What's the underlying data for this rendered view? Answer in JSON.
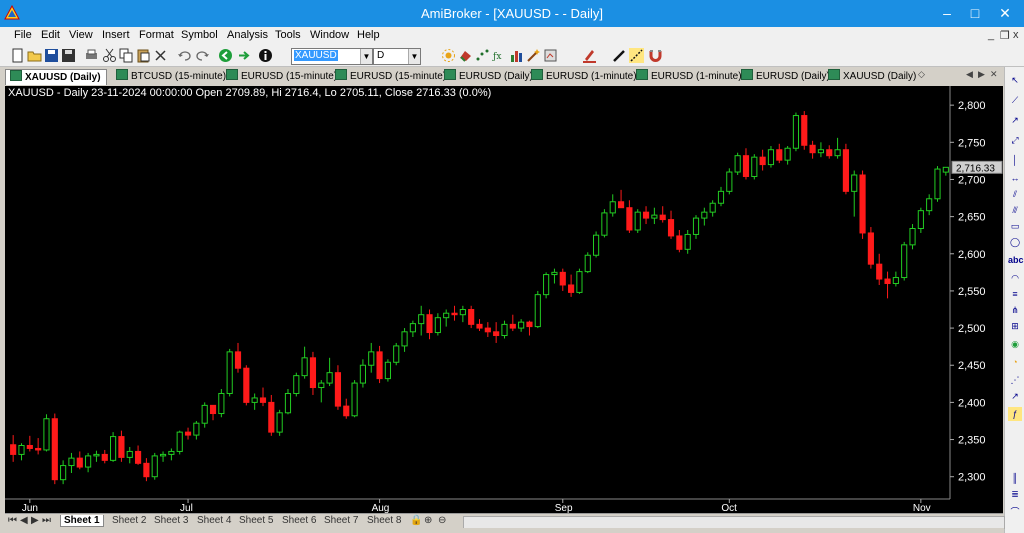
{
  "window": {
    "title": "AmiBroker - [XAUUSD -  - Daily]",
    "minimize": "–",
    "maximize": "□",
    "close": "✕",
    "mdi_min": "_",
    "mdi_restore": "❐",
    "mdi_close": "x"
  },
  "menu": [
    "File",
    "Edit",
    "View",
    "Insert",
    "Format",
    "Symbol",
    "Analysis",
    "Tools",
    "Window",
    "Help"
  ],
  "toolbar": {
    "symbol": "XAUUSD",
    "interval": "D"
  },
  "tabs": [
    "XAUUSD (Daily)",
    "BTCUSD (15-minute)",
    "EURUSD (15-minute)",
    "EURUSD (15-minute)",
    "EURUSD (Daily)",
    "EURUSD (1-minute)",
    "EURUSD (1-minute)",
    "EURUSD (Daily)",
    "XAUUSD (Daily)"
  ],
  "chart_info": "XAUUSD - Daily 23-11-2024 00:00:00 Open 2709.89, Hi 2716.4, Lo 2705.11, Close 2716.33 (0.0%)",
  "sheets": [
    "Sheet 1",
    "Sheet 2",
    "Sheet 3",
    "Sheet 4",
    "Sheet 5",
    "Sheet 6",
    "Sheet 7",
    "Sheet 8"
  ],
  "colors": {
    "up": "#22cc22",
    "down": "#ff1a1a",
    "background": "#000000",
    "axis_text": "#ffffff",
    "price_tag": "#cfcfcf"
  },
  "chart_data": {
    "type": "candlestick",
    "title": "XAUUSD - Daily 23-11-2024 00:00:00 Open 2709.89, Hi 2716.4, Lo 2705.11, Close 2716.33 (0.0%)",
    "ylim": [
      2270,
      2815
    ],
    "yticks": [
      2300,
      2350,
      2400,
      2450,
      2500,
      2550,
      2600,
      2650,
      2700,
      2750,
      2800
    ],
    "ytick_labels": [
      "2,300",
      "2,350",
      "2,400",
      "2,450",
      "2,500",
      "2,550",
      "2,600",
      "2,650",
      "2,700",
      "2,750",
      "2,800"
    ],
    "x_month_labels": [
      {
        "label": "Jun",
        "index": 2
      },
      {
        "label": "Jul",
        "index": 21
      },
      {
        "label": "Aug",
        "index": 44
      },
      {
        "label": "Sep",
        "index": 66
      },
      {
        "label": "Oct",
        "index": 86
      },
      {
        "label": "Nov",
        "index": 109
      }
    ],
    "last_price_label": "2,716.33",
    "last_price": 2716.33,
    "candles": [
      [
        2343,
        2356,
        2320,
        2330
      ],
      [
        2330,
        2345,
        2322,
        2342
      ],
      [
        2342,
        2355,
        2334,
        2338
      ],
      [
        2338,
        2352,
        2330,
        2336
      ],
      [
        2336,
        2384,
        2334,
        2378
      ],
      [
        2378,
        2385,
        2290,
        2296
      ],
      [
        2296,
        2322,
        2290,
        2315
      ],
      [
        2315,
        2332,
        2305,
        2325
      ],
      [
        2325,
        2334,
        2310,
        2313
      ],
      [
        2313,
        2332,
        2306,
        2328
      ],
      [
        2328,
        2335,
        2320,
        2330
      ],
      [
        2330,
        2336,
        2318,
        2322
      ],
      [
        2322,
        2360,
        2320,
        2354
      ],
      [
        2354,
        2362,
        2320,
        2326
      ],
      [
        2326,
        2340,
        2318,
        2334
      ],
      [
        2334,
        2342,
        2316,
        2318
      ],
      [
        2318,
        2325,
        2294,
        2300
      ],
      [
        2300,
        2332,
        2296,
        2328
      ],
      [
        2328,
        2334,
        2320,
        2330
      ],
      [
        2330,
        2338,
        2322,
        2334
      ],
      [
        2334,
        2362,
        2330,
        2360
      ],
      [
        2360,
        2366,
        2350,
        2356
      ],
      [
        2356,
        2375,
        2350,
        2372
      ],
      [
        2372,
        2400,
        2366,
        2396
      ],
      [
        2396,
        2395,
        2376,
        2385
      ],
      [
        2385,
        2418,
        2380,
        2412
      ],
      [
        2412,
        2472,
        2408,
        2468
      ],
      [
        2468,
        2480,
        2440,
        2446
      ],
      [
        2446,
        2450,
        2396,
        2400
      ],
      [
        2400,
        2412,
        2390,
        2406
      ],
      [
        2406,
        2420,
        2395,
        2400
      ],
      [
        2400,
        2410,
        2355,
        2360
      ],
      [
        2360,
        2390,
        2355,
        2386
      ],
      [
        2386,
        2418,
        2384,
        2412
      ],
      [
        2412,
        2440,
        2408,
        2436
      ],
      [
        2436,
        2475,
        2432,
        2460
      ],
      [
        2460,
        2468,
        2410,
        2420
      ],
      [
        2420,
        2430,
        2400,
        2426
      ],
      [
        2426,
        2460,
        2422,
        2440
      ],
      [
        2440,
        2450,
        2390,
        2395
      ],
      [
        2395,
        2405,
        2378,
        2382
      ],
      [
        2382,
        2430,
        2380,
        2426
      ],
      [
        2426,
        2458,
        2420,
        2450
      ],
      [
        2450,
        2480,
        2440,
        2468
      ],
      [
        2468,
        2476,
        2426,
        2432
      ],
      [
        2432,
        2458,
        2428,
        2454
      ],
      [
        2454,
        2480,
        2450,
        2476
      ],
      [
        2476,
        2500,
        2468,
        2495
      ],
      [
        2495,
        2510,
        2488,
        2506
      ],
      [
        2506,
        2530,
        2490,
        2518
      ],
      [
        2518,
        2525,
        2485,
        2494
      ],
      [
        2494,
        2520,
        2490,
        2514
      ],
      [
        2514,
        2525,
        2502,
        2520
      ],
      [
        2520,
        2530,
        2510,
        2518
      ],
      [
        2518,
        2530,
        2508,
        2525
      ],
      [
        2525,
        2530,
        2500,
        2505
      ],
      [
        2505,
        2512,
        2496,
        2500
      ],
      [
        2500,
        2508,
        2488,
        2495
      ],
      [
        2495,
        2508,
        2480,
        2490
      ],
      [
        2490,
        2510,
        2486,
        2505
      ],
      [
        2505,
        2518,
        2496,
        2500
      ],
      [
        2500,
        2512,
        2495,
        2508
      ],
      [
        2508,
        2510,
        2490,
        2502
      ],
      [
        2502,
        2550,
        2500,
        2545
      ],
      [
        2545,
        2575,
        2540,
        2572
      ],
      [
        2572,
        2580,
        2560,
        2575
      ],
      [
        2575,
        2580,
        2550,
        2558
      ],
      [
        2558,
        2572,
        2542,
        2548
      ],
      [
        2548,
        2580,
        2546,
        2576
      ],
      [
        2576,
        2602,
        2574,
        2598
      ],
      [
        2598,
        2630,
        2595,
        2625
      ],
      [
        2625,
        2660,
        2622,
        2655
      ],
      [
        2655,
        2680,
        2650,
        2670
      ],
      [
        2670,
        2686,
        2665,
        2662
      ],
      [
        2662,
        2672,
        2628,
        2632
      ],
      [
        2632,
        2660,
        2628,
        2656
      ],
      [
        2656,
        2664,
        2640,
        2648
      ],
      [
        2648,
        2662,
        2640,
        2652
      ],
      [
        2652,
        2664,
        2642,
        2646
      ],
      [
        2646,
        2658,
        2620,
        2624
      ],
      [
        2624,
        2632,
        2602,
        2606
      ],
      [
        2606,
        2632,
        2600,
        2626
      ],
      [
        2626,
        2652,
        2620,
        2648
      ],
      [
        2648,
        2662,
        2638,
        2656
      ],
      [
        2656,
        2672,
        2650,
        2668
      ],
      [
        2668,
        2690,
        2664,
        2684
      ],
      [
        2684,
        2715,
        2680,
        2710
      ],
      [
        2710,
        2736,
        2706,
        2732
      ],
      [
        2732,
        2742,
        2700,
        2704
      ],
      [
        2704,
        2734,
        2700,
        2730
      ],
      [
        2730,
        2740,
        2712,
        2720
      ],
      [
        2720,
        2745,
        2716,
        2740
      ],
      [
        2740,
        2748,
        2722,
        2726
      ],
      [
        2726,
        2745,
        2720,
        2742
      ],
      [
        2742,
        2790,
        2738,
        2786
      ],
      [
        2786,
        2792,
        2740,
        2746
      ],
      [
        2746,
        2752,
        2728,
        2736
      ],
      [
        2736,
        2750,
        2730,
        2740
      ],
      [
        2740,
        2746,
        2728,
        2732
      ],
      [
        2732,
        2756,
        2728,
        2740
      ],
      [
        2740,
        2748,
        2680,
        2684
      ],
      [
        2684,
        2712,
        2650,
        2706
      ],
      [
        2706,
        2712,
        2620,
        2628
      ],
      [
        2628,
        2636,
        2580,
        2586
      ],
      [
        2586,
        2600,
        2558,
        2566
      ],
      [
        2566,
        2576,
        2540,
        2560
      ],
      [
        2560,
        2576,
        2556,
        2568
      ],
      [
        2568,
        2616,
        2564,
        2612
      ],
      [
        2612,
        2640,
        2606,
        2634
      ],
      [
        2634,
        2662,
        2628,
        2658
      ],
      [
        2658,
        2680,
        2652,
        2674
      ],
      [
        2674,
        2718,
        2670,
        2714
      ],
      [
        2709.89,
        2716.4,
        2705.11,
        2716.33
      ]
    ]
  }
}
